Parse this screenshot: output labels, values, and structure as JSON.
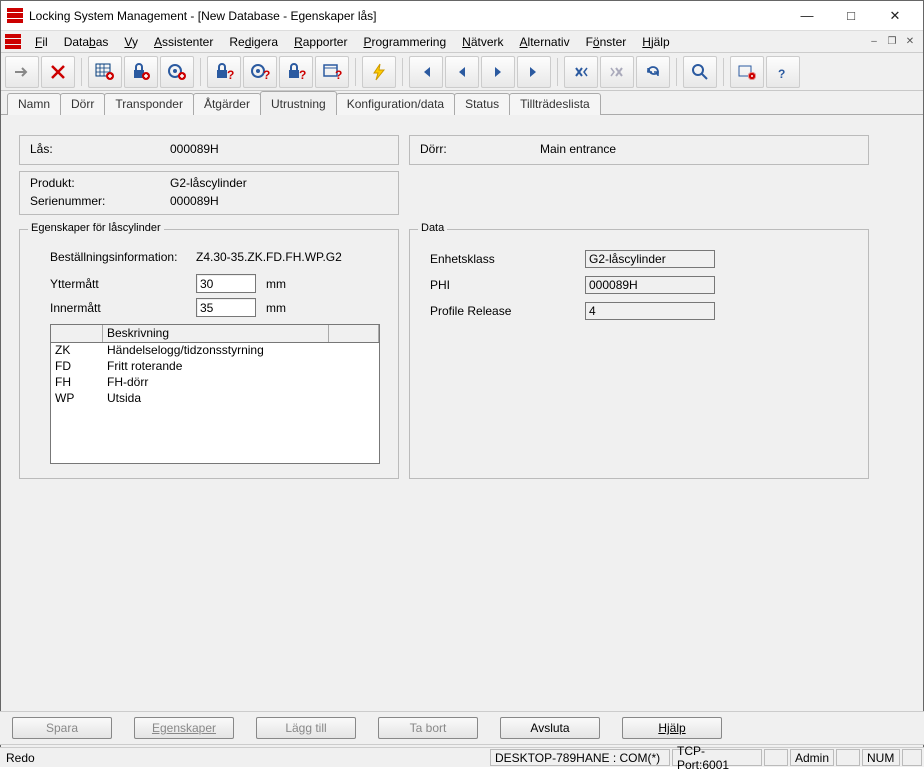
{
  "title": "Locking System Management - [New Database - Egenskaper lås]",
  "menu": {
    "items": [
      {
        "u": "F",
        "rest": "il"
      },
      {
        "u": "",
        "pre": "Data",
        "urest": "b",
        "rest": "as"
      },
      {
        "u": "V",
        "rest": "y"
      },
      {
        "u": "A",
        "rest": "ssistenter"
      },
      {
        "u": "",
        "pre": "Re",
        "urest": "d",
        "rest": "igera"
      },
      {
        "u": "R",
        "rest": "apporter"
      },
      {
        "u": "P",
        "rest": "rogrammering"
      },
      {
        "u": "N",
        "rest": "ätverk"
      },
      {
        "u": "A",
        "rest": "lternativ"
      },
      {
        "u": "",
        "pre": "F",
        "urest": "ö",
        "rest": "nster"
      },
      {
        "u": "H",
        "rest": "jälp"
      }
    ]
  },
  "tabs": [
    "Namn",
    "Dörr",
    "Transponder",
    "Åtgärder",
    "Utrustning",
    "Konfiguration/data",
    "Status",
    "Tillträdeslista"
  ],
  "activeTab": 4,
  "info": {
    "lasLabel": "Lås:",
    "lasValue": "000089H",
    "dorrLabel": "Dörr:",
    "dorrValue": "Main entrance",
    "produktLabel": "Produkt:",
    "produktValue": "G2-låscylinder",
    "serieLabel": "Serienummer:",
    "serieValue": "000089H"
  },
  "cylinder": {
    "groupTitle": "Egenskaper för låscylinder",
    "bestLabel": "Beställningsinformation:",
    "bestValue": "Z4.30-35.ZK.FD.FH.WP.G2",
    "ytterLabel": "Yttermått",
    "ytterValue": "30",
    "ytterUnit": "mm",
    "innerLabel": "Innermått",
    "innerValue": "35",
    "innerUnit": "mm",
    "gridHeader": "Beskrivning",
    "rows": [
      {
        "code": "ZK",
        "desc": "Händelselogg/tidzonsstyrning"
      },
      {
        "code": "FD",
        "desc": "Fritt roterande"
      },
      {
        "code": "FH",
        "desc": "FH-dörr"
      },
      {
        "code": "WP",
        "desc": "Utsida"
      }
    ]
  },
  "data": {
    "groupTitle": "Data",
    "enhetLabel": "Enhetsklass",
    "enhetValue": "G2-låscylinder",
    "phiLabel": "PHI",
    "phiValue": "000089H",
    "profLabel": "Profile Release",
    "profValue": "4"
  },
  "buttons": {
    "spara": "Spara",
    "egenskaper": "Egenskaper",
    "lagg": "Lägg till",
    "tabort": "Ta bort",
    "avsluta": "Avsluta",
    "hjalp": "Hjälp"
  },
  "status": {
    "ready": "Redo",
    "host": "DESKTOP-789HANE : COM(*)",
    "tcp": "TCP-Port:6001",
    "admin": "Admin",
    "num": "NUM"
  }
}
